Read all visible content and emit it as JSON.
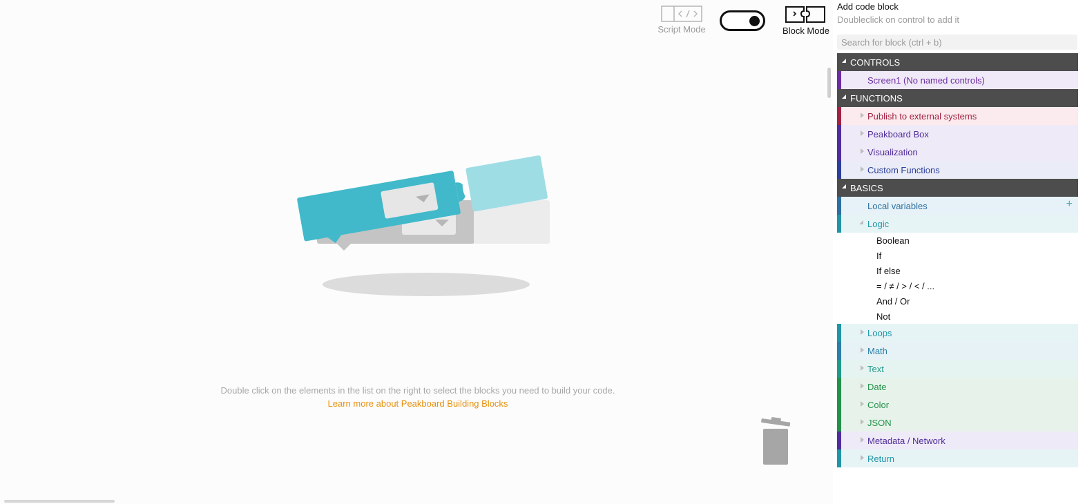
{
  "toolbar": {
    "script_mode_label": "Script Mode",
    "block_mode_label": "Block Mode",
    "block_mode_active": true
  },
  "canvas": {
    "hint": "Double click on the elements in the list on the right to select the blocks you need to build your code.",
    "learn_more": "Learn more about Peakboard Building Blocks"
  },
  "panel": {
    "title": "Add code block",
    "subtitle": "Doubleclick on control to add it",
    "search_placeholder": "Search for block (ctrl + b)"
  },
  "colors": {
    "category_header": "#4d4d4d",
    "link": "#e8900a",
    "puzzle_teal": "#41b9ca",
    "puzzle_light_teal": "#9fdde5"
  },
  "categories": {
    "controls": {
      "label": "CONTROLS",
      "items": [
        {
          "label": "Screen1 (No named controls)",
          "color": "#6b2d9f",
          "bg": "#f0e9f7",
          "bar": "#6b2d9f"
        }
      ]
    },
    "functions": {
      "label": "FUNCTIONS",
      "items": [
        {
          "label": "Publish to external systems",
          "color": "#a02342",
          "bg": "#fbeaee",
          "bar": "#a02342"
        },
        {
          "label": "Peakboard Box",
          "color": "#4f2d9b",
          "bg": "#efeaf7",
          "bar": "#4f2d9b"
        },
        {
          "label": "Visualization",
          "color": "#4f2d9b",
          "bg": "#efeaf7",
          "bar": "#4f2d9b"
        },
        {
          "label": "Custom Functions",
          "color": "#2d3f9b",
          "bg": "#eaedf7",
          "bar": "#2d3f9b"
        }
      ]
    },
    "basics": {
      "label": "BASICS",
      "local_variables": {
        "label": "Local variables",
        "color": "#2d6fa0",
        "bg": "#e6f2f7",
        "bar": "#2d6fa0",
        "add_icon": "+"
      },
      "logic": {
        "label": "Logic",
        "color": "#1f95a6",
        "bg": "#e6f4f6",
        "bar": "#1f95a6",
        "children": [
          "Boolean",
          "If",
          "If else",
          "= / ≠ / > / < / ...",
          "And / Or",
          "Not"
        ]
      },
      "items": [
        {
          "label": "Loops",
          "color": "#1f95a6",
          "bg": "#e6f4f6",
          "bar": "#1f95a6"
        },
        {
          "label": "Math",
          "color": "#2a7fa8",
          "bg": "#e6f2f6",
          "bar": "#2a7fa8"
        },
        {
          "label": "Text",
          "color": "#1f9a8a",
          "bg": "#e6f4f1",
          "bar": "#1f9a8a"
        },
        {
          "label": "Date",
          "color": "#23914a",
          "bg": "#e7f3ea",
          "bar": "#23914a"
        },
        {
          "label": "Color",
          "color": "#23914a",
          "bg": "#e7f3ea",
          "bar": "#23914a"
        },
        {
          "label": "JSON",
          "color": "#23914a",
          "bg": "#e7f3ea",
          "bar": "#23914a"
        },
        {
          "label": "Metadata / Network",
          "color": "#4f2d9b",
          "bg": "#efeaf7",
          "bar": "#4f2d9b"
        },
        {
          "label": "Return",
          "color": "#1f95a6",
          "bg": "#e6f4f6",
          "bar": "#1f95a6"
        }
      ]
    }
  }
}
